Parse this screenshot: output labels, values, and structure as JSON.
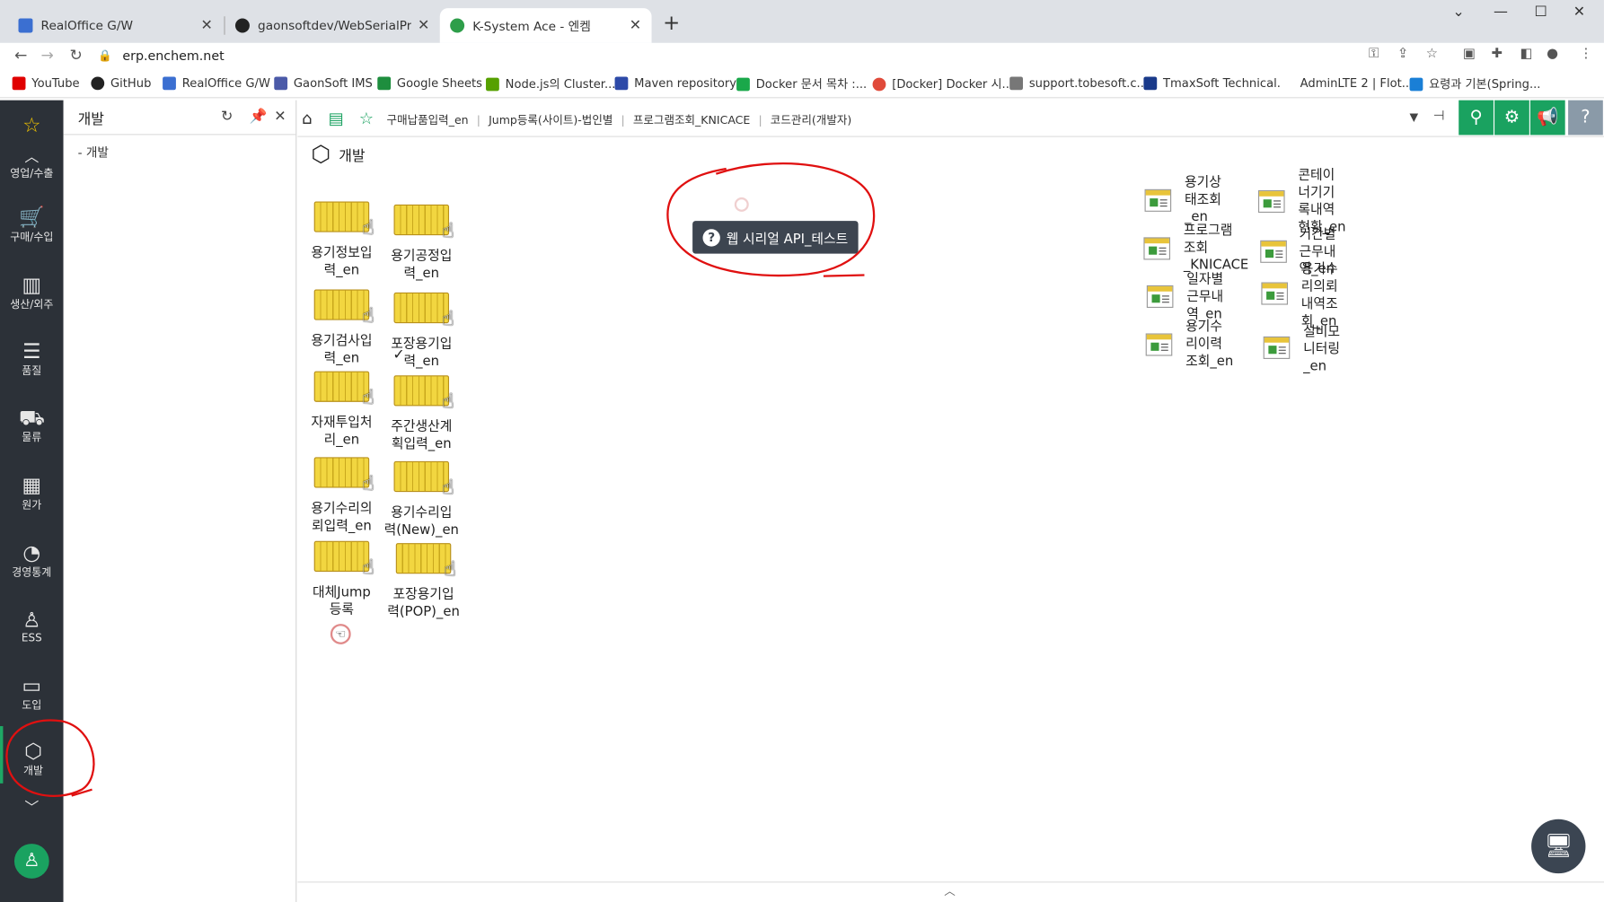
{
  "browser": {
    "tabs": [
      {
        "title": "RealOffice G/W",
        "color": "#3b6fd1"
      },
      {
        "title": "gaonsoftdev/WebSerialProvider",
        "color": "#222222"
      },
      {
        "title": "K-System Ace - 엔켐",
        "color": "#2e9e4a"
      }
    ],
    "new_tab": "+",
    "url": "erp.enchem.net",
    "bookmarks": [
      {
        "label": "YouTube",
        "color": "#e00000"
      },
      {
        "label": "GitHub",
        "color": "#222222"
      },
      {
        "label": "RealOffice G/W",
        "color": "#3b6fd1"
      },
      {
        "label": "GaonSoft IMS",
        "color": "#4b5aa8"
      },
      {
        "label": "Google Sheets",
        "color": "#1e8e3e"
      },
      {
        "label": "Node.js의 Cluster...",
        "color": "#56a000"
      },
      {
        "label": "Maven repository",
        "color": "#2d4aa8"
      },
      {
        "label": "Docker 문서 목차 :...",
        "color": "#1aa84a"
      },
      {
        "label": "[Docker] Docker 시...",
        "color": "#e04a3a"
      },
      {
        "label": "support.tobesoft.c...",
        "color": "#777777"
      },
      {
        "label": "TmaxSoft Technical...",
        "color": "#1a3a8a"
      },
      {
        "label": "AdminLTE 2 | Flot...",
        "color": "#ffffff"
      },
      {
        "label": "요령과 기본(Spring...",
        "color": "#1a7fd6"
      }
    ]
  },
  "sidebar": {
    "items": [
      {
        "label": "영업/수출",
        "icon": "chevron-up-icon"
      },
      {
        "label": "구매/수입",
        "icon": "cart-icon"
      },
      {
        "label": "생산/외주",
        "icon": "factory-icon"
      },
      {
        "label": "품질",
        "icon": "checklist-icon"
      },
      {
        "label": "물류",
        "icon": "truck-icon"
      },
      {
        "label": "원가",
        "icon": "calculator-icon"
      },
      {
        "label": "경영통계",
        "icon": "pie-chart-icon"
      },
      {
        "label": "ESS",
        "icon": "user-check-icon"
      },
      {
        "label": "도입",
        "icon": "monitor-icon"
      },
      {
        "label": "개발",
        "icon": "cube-icon"
      }
    ]
  },
  "submenu": {
    "title": "개발",
    "item": "- 개발"
  },
  "topbar": {
    "breadcrumbs": [
      "구매납품입력_en",
      "Jump등록(사이트)-법인별",
      "프로그램조회_KNICACE",
      "코드관리(개발자)"
    ]
  },
  "page": {
    "title": "개발"
  },
  "tiles": [
    {
      "label": "용기정보입\n력_en"
    },
    {
      "label": "용기공정입\n력_en"
    },
    {
      "label": "용기검사입\n력_en"
    },
    {
      "label": "포장용기입\n력_en"
    },
    {
      "label": "자재투입처\n리_en"
    },
    {
      "label": "주간생산계\n획입력_en"
    },
    {
      "label": "용기수리의\n뢰입력_en"
    },
    {
      "label": "용기수리입\n력(New)_en"
    },
    {
      "label": "대체Jump\n등록"
    },
    {
      "label": "포장용기입\n력(POP)_en"
    }
  ],
  "reports": [
    "용기상\n태조회\n_en",
    "프로그램\n조회\n_KNICACE",
    "일자별\n근무내\n역_en",
    "용기수\n리이력\n조회_en",
    "콘테이\n너기기\n록내역\n현황_en",
    "기간별\n근무내\n역_en",
    "용기수\n리의뢰\n내역조\n회_en",
    "설비모\n니터링\n_en"
  ],
  "api_button": {
    "label": "웹 시리얼 API_테스트"
  }
}
